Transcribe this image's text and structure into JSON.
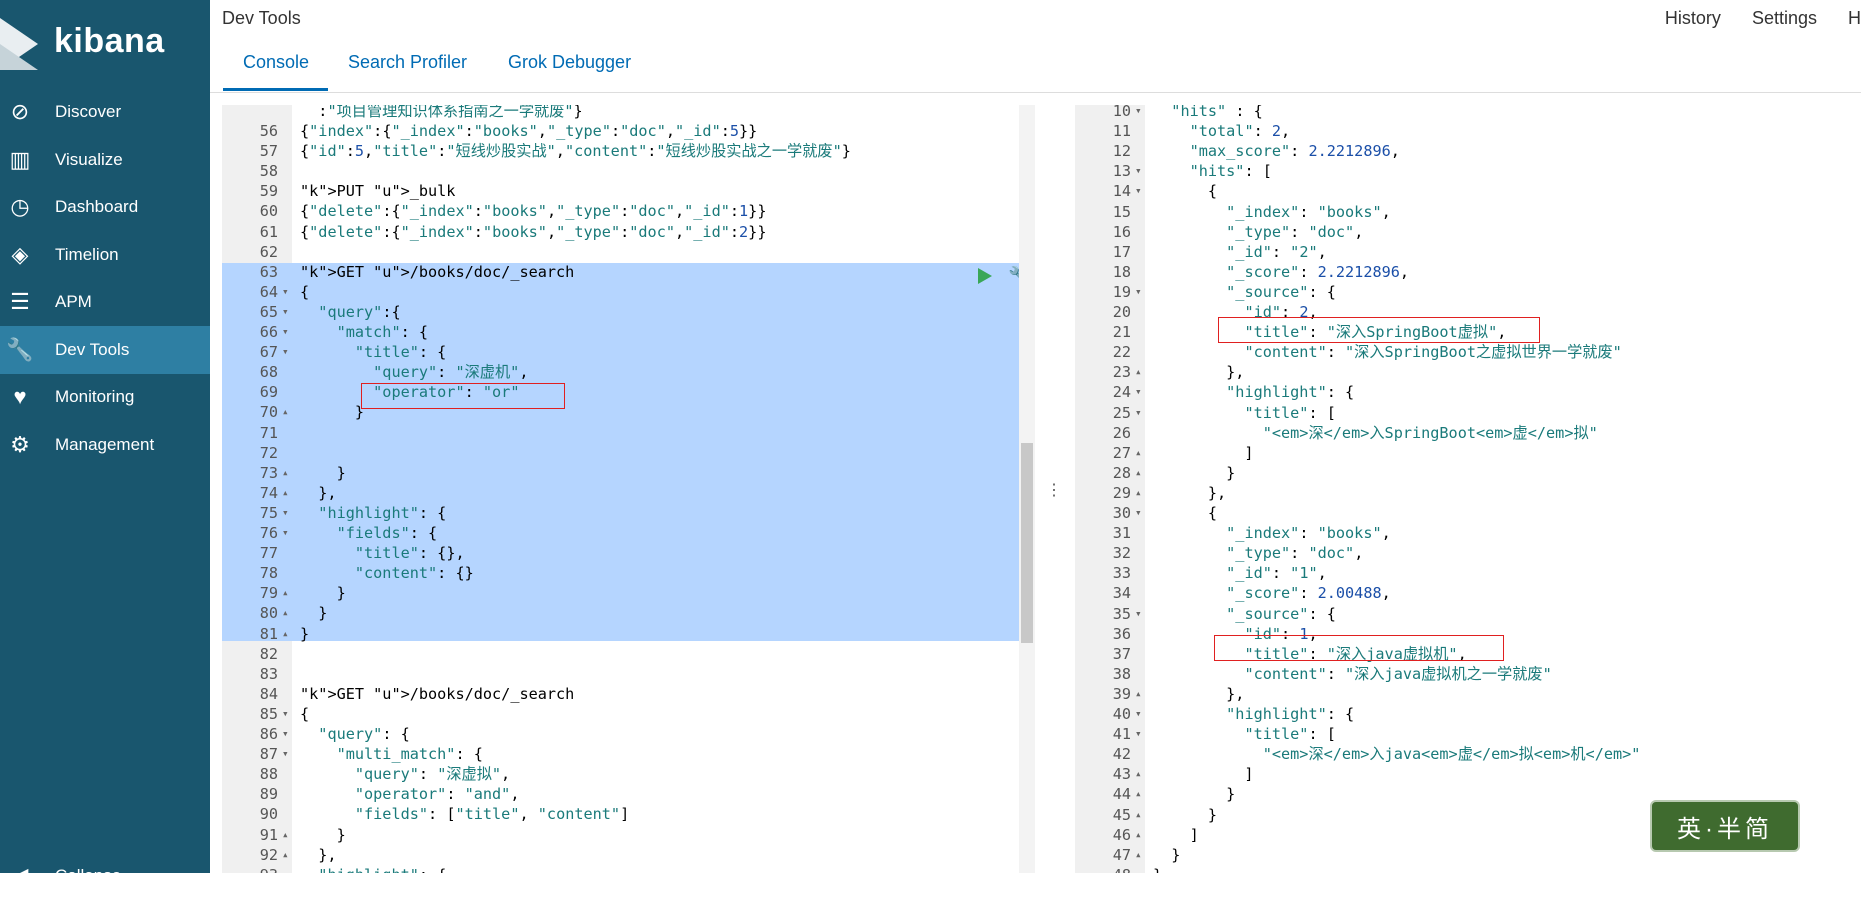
{
  "sidebar": {
    "logo": "kibana",
    "items": [
      {
        "label": "Discover",
        "icon": "compass-icon",
        "glyph": "⊘"
      },
      {
        "label": "Visualize",
        "icon": "bar-chart-icon",
        "glyph": "▥"
      },
      {
        "label": "Dashboard",
        "icon": "dashboard-icon",
        "glyph": "◷"
      },
      {
        "label": "Timelion",
        "icon": "timelion-icon",
        "glyph": "◈"
      },
      {
        "label": "APM",
        "icon": "apm-icon",
        "glyph": "☰"
      },
      {
        "label": "Dev Tools",
        "icon": "wrench-icon",
        "glyph": "🔧",
        "active": true
      },
      {
        "label": "Monitoring",
        "icon": "heartbeat-icon",
        "glyph": "♥"
      },
      {
        "label": "Management",
        "icon": "gear-icon",
        "glyph": "⚙"
      }
    ],
    "collapse": "Collapse"
  },
  "header": {
    "title": "Dev Tools",
    "links": [
      "History",
      "Settings",
      "H"
    ],
    "tabs": [
      "Console",
      "Search Profiler",
      "Grok Debugger"
    ]
  },
  "left_editor": {
    "first_partial": "  :\"项目管理知识体系指南之一学就废\"}",
    "lines": [
      {
        "n": "56",
        "f": "",
        "t": "{\"index\":{\"_index\":\"books\",\"_type\":\"doc\",\"_id\":5}}"
      },
      {
        "n": "57",
        "f": "",
        "t": "{\"id\":5,\"title\":\"短线炒股实战\",\"content\":\"短线炒股实战之一学就废\"}"
      },
      {
        "n": "58",
        "f": "",
        "t": ""
      },
      {
        "n": "59",
        "f": "",
        "t": "PUT _bulk"
      },
      {
        "n": "60",
        "f": "",
        "t": "{\"delete\":{\"_index\":\"books\",\"_type\":\"doc\",\"_id\":1}}"
      },
      {
        "n": "61",
        "f": "",
        "t": "{\"delete\":{\"_index\":\"books\",\"_type\":\"doc\",\"_id\":2}}"
      },
      {
        "n": "62",
        "f": "",
        "t": ""
      },
      {
        "n": "63",
        "f": "",
        "t": "GET /books/doc/_search"
      },
      {
        "n": "64",
        "f": "▾",
        "t": "{"
      },
      {
        "n": "65",
        "f": "▾",
        "t": "  \"query\":{"
      },
      {
        "n": "66",
        "f": "▾",
        "t": "    \"match\": {"
      },
      {
        "n": "67",
        "f": "▾",
        "t": "      \"title\": {"
      },
      {
        "n": "68",
        "f": "",
        "t": "        \"query\": \"深虚机\","
      },
      {
        "n": "69",
        "f": "",
        "t": "        \"operator\": \"or\""
      },
      {
        "n": "70",
        "f": "▴",
        "t": "      }"
      },
      {
        "n": "71",
        "f": "",
        "t": ""
      },
      {
        "n": "72",
        "f": "",
        "t": ""
      },
      {
        "n": "73",
        "f": "▴",
        "t": "    }"
      },
      {
        "n": "74",
        "f": "▴",
        "t": "  },"
      },
      {
        "n": "75",
        "f": "▾",
        "t": "  \"highlight\": {"
      },
      {
        "n": "76",
        "f": "▾",
        "t": "    \"fields\": {"
      },
      {
        "n": "77",
        "f": "",
        "t": "      \"title\": {},"
      },
      {
        "n": "78",
        "f": "",
        "t": "      \"content\": {}"
      },
      {
        "n": "79",
        "f": "▴",
        "t": "    }"
      },
      {
        "n": "80",
        "f": "▴",
        "t": "  }"
      },
      {
        "n": "81",
        "f": "▴",
        "t": "}"
      },
      {
        "n": "82",
        "f": "",
        "t": ""
      },
      {
        "n": "83",
        "f": "",
        "t": ""
      },
      {
        "n": "84",
        "f": "",
        "t": "GET /books/doc/_search"
      },
      {
        "n": "85",
        "f": "▾",
        "t": "{"
      },
      {
        "n": "86",
        "f": "▾",
        "t": "  \"query\": {"
      },
      {
        "n": "87",
        "f": "▾",
        "t": "    \"multi_match\": {"
      },
      {
        "n": "88",
        "f": "",
        "t": "      \"query\": \"深虚拟\","
      },
      {
        "n": "89",
        "f": "",
        "t": "      \"operator\": \"and\","
      },
      {
        "n": "90",
        "f": "",
        "t": "      \"fields\": [\"title\", \"content\"]"
      },
      {
        "n": "91",
        "f": "▴",
        "t": "    }"
      },
      {
        "n": "92",
        "f": "▴",
        "t": "  },"
      },
      {
        "n": "93",
        "f": "▾",
        "t": "  \"highlight\": {"
      }
    ]
  },
  "right_editor": {
    "lines": [
      {
        "n": "10",
        "f": "▾",
        "t": "  \"hits\" : {"
      },
      {
        "n": "11",
        "f": "",
        "t": "    \"total\": 2,"
      },
      {
        "n": "12",
        "f": "",
        "t": "    \"max_score\": 2.2212896,"
      },
      {
        "n": "13",
        "f": "▾",
        "t": "    \"hits\": ["
      },
      {
        "n": "14",
        "f": "▾",
        "t": "      {"
      },
      {
        "n": "15",
        "f": "",
        "t": "        \"_index\": \"books\","
      },
      {
        "n": "16",
        "f": "",
        "t": "        \"_type\": \"doc\","
      },
      {
        "n": "17",
        "f": "",
        "t": "        \"_id\": \"2\","
      },
      {
        "n": "18",
        "f": "",
        "t": "        \"_score\": 2.2212896,"
      },
      {
        "n": "19",
        "f": "▾",
        "t": "        \"_source\": {"
      },
      {
        "n": "20",
        "f": "",
        "t": "          \"id\": 2,"
      },
      {
        "n": "21",
        "f": "",
        "t": "          \"title\": \"深入SpringBoot虚拟\","
      },
      {
        "n": "22",
        "f": "",
        "t": "          \"content\": \"深入SpringBoot之虚拟世界一学就废\""
      },
      {
        "n": "23",
        "f": "▴",
        "t": "        },"
      },
      {
        "n": "24",
        "f": "▾",
        "t": "        \"highlight\": {"
      },
      {
        "n": "25",
        "f": "▾",
        "t": "          \"title\": ["
      },
      {
        "n": "26",
        "f": "",
        "t": "            \"<em>深</em>入SpringBoot<em>虚</em>拟\""
      },
      {
        "n": "27",
        "f": "▴",
        "t": "          ]"
      },
      {
        "n": "28",
        "f": "▴",
        "t": "        }"
      },
      {
        "n": "29",
        "f": "▴",
        "t": "      },"
      },
      {
        "n": "30",
        "f": "▾",
        "t": "      {"
      },
      {
        "n": "31",
        "f": "",
        "t": "        \"_index\": \"books\","
      },
      {
        "n": "32",
        "f": "",
        "t": "        \"_type\": \"doc\","
      },
      {
        "n": "33",
        "f": "",
        "t": "        \"_id\": \"1\","
      },
      {
        "n": "34",
        "f": "",
        "t": "        \"_score\": 2.00488,"
      },
      {
        "n": "35",
        "f": "▾",
        "t": "        \"_source\": {"
      },
      {
        "n": "36",
        "f": "",
        "t": "          \"id\": 1,"
      },
      {
        "n": "37",
        "f": "",
        "t": "          \"title\": \"深入java虚拟机\","
      },
      {
        "n": "38",
        "f": "",
        "t": "          \"content\": \"深入java虚拟机之一学就废\""
      },
      {
        "n": "39",
        "f": "▴",
        "t": "        },"
      },
      {
        "n": "40",
        "f": "▾",
        "t": "        \"highlight\": {"
      },
      {
        "n": "41",
        "f": "▾",
        "t": "          \"title\": ["
      },
      {
        "n": "42",
        "f": "",
        "t": "            \"<em>深</em>入java<em>虚</em>拟<em>机</em>\""
      },
      {
        "n": "43",
        "f": "▴",
        "t": "          ]"
      },
      {
        "n": "44",
        "f": "▴",
        "t": "        }"
      },
      {
        "n": "45",
        "f": "▴",
        "t": "      }"
      },
      {
        "n": "46",
        "f": "▴",
        "t": "    ]"
      },
      {
        "n": "47",
        "f": "▴",
        "t": "  }"
      },
      {
        "n": "48",
        "f": "▴",
        "t": "}"
      }
    ]
  },
  "stamp": "英·半简",
  "colors": {
    "sidebar": "#19566e",
    "active": "#2e7fa3",
    "link": "#006bb4",
    "selection": "#b5d5ff",
    "redbox": "#e02020"
  }
}
